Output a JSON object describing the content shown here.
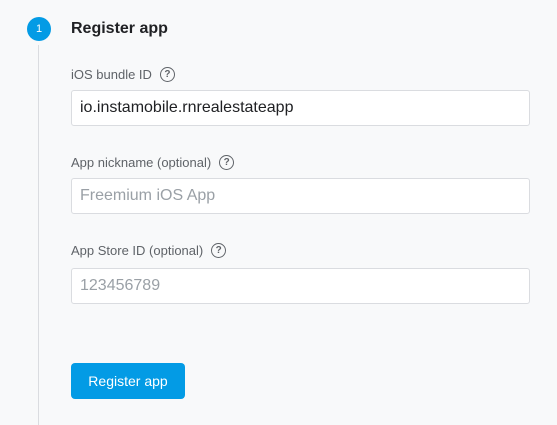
{
  "step": {
    "number": "1",
    "title": "Register app"
  },
  "fields": {
    "bundle_id": {
      "label": "iOS bundle ID",
      "help_icon": "help-circle-icon",
      "value": "io.instamobile.rnrealestateapp",
      "placeholder": ""
    },
    "nickname": {
      "label": "App nickname (optional)",
      "help_icon": "help-circle-icon",
      "value": "",
      "placeholder": "Freemium iOS App"
    },
    "app_store_id": {
      "label": "App Store ID (optional)",
      "help_icon": "help-circle-icon",
      "value": "",
      "placeholder": "123456789"
    }
  },
  "actions": {
    "register_label": "Register app"
  },
  "colors": {
    "accent": "#039be5",
    "background": "#f8f9fa",
    "border": "#dadce0",
    "label": "#5f6368",
    "placeholder": "#9aa0a6"
  }
}
